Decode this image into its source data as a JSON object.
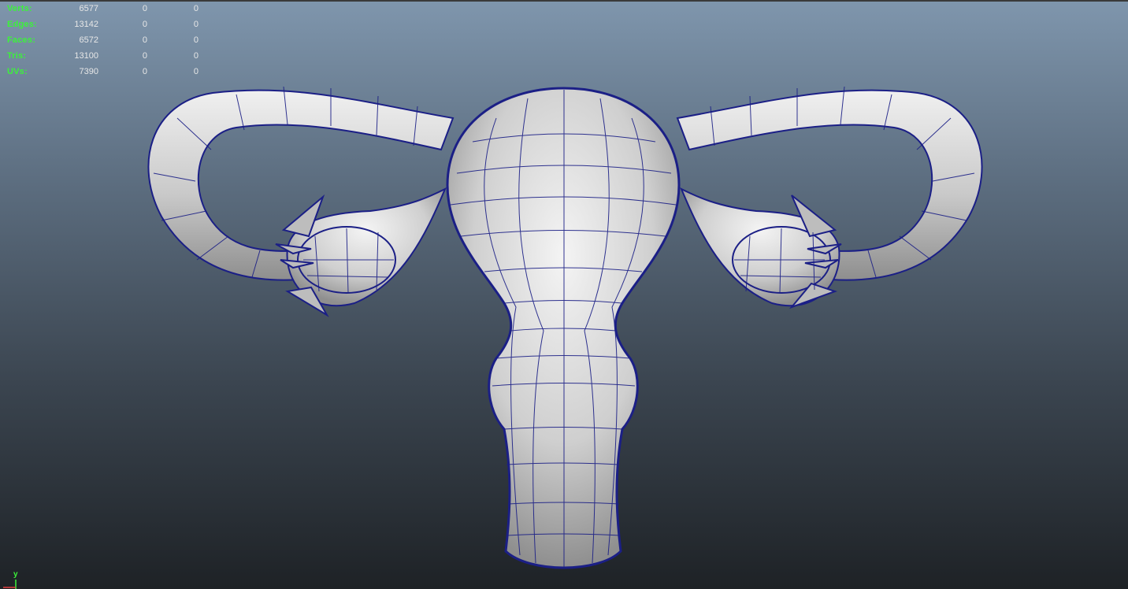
{
  "hud": {
    "rows": [
      {
        "label": "Verts:",
        "v1": "6577",
        "v2": "0",
        "v3": "0"
      },
      {
        "label": "Edges:",
        "v1": "13142",
        "v2": "0",
        "v3": "0"
      },
      {
        "label": "Faces:",
        "v1": "6572",
        "v2": "0",
        "v3": "0"
      },
      {
        "label": "Tris:",
        "v1": "13100",
        "v2": "0",
        "v3": "0"
      },
      {
        "label": "UVs:",
        "v1": "7390",
        "v2": "0",
        "v3": "0"
      }
    ]
  },
  "axis": {
    "label": "y"
  },
  "colors": {
    "wire": "#1b1f86",
    "surface": "#d8d8d8",
    "hud_label": "#3cf23a",
    "hud_value": "#e7e7e7"
  },
  "icons": {
    "view_axis": "axis-gizmo-icon"
  }
}
